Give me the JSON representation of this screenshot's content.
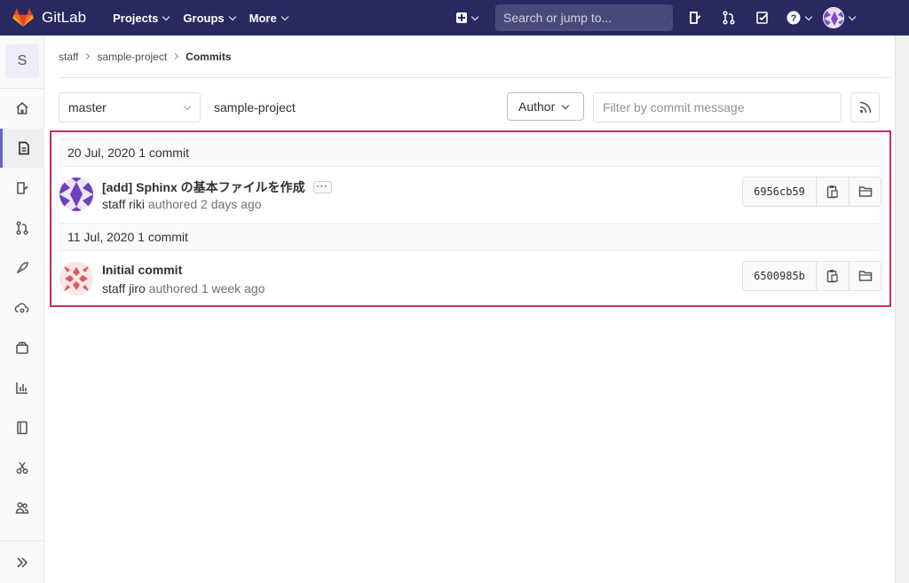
{
  "navbar": {
    "brand": "GitLab",
    "menu": [
      {
        "label": "Projects"
      },
      {
        "label": "Groups"
      },
      {
        "label": "More"
      }
    ],
    "search_placeholder": "Search or jump to..."
  },
  "sidebar": {
    "project_initial": "S",
    "items": [
      {
        "icon": "home-icon"
      },
      {
        "icon": "repository-icon"
      },
      {
        "icon": "issues-icon"
      },
      {
        "icon": "merge-request-icon"
      },
      {
        "icon": "ci-cd-rocket-icon"
      },
      {
        "icon": "operations-cloud-icon"
      },
      {
        "icon": "packages-icon"
      },
      {
        "icon": "analytics-icon"
      },
      {
        "icon": "wiki-book-icon"
      },
      {
        "icon": "snippets-scissors-icon"
      },
      {
        "icon": "members-icon"
      },
      {
        "icon": "collapse-sidebar-icon"
      }
    ]
  },
  "breadcrumbs": [
    "staff",
    "sample-project",
    "Commits"
  ],
  "toolbar": {
    "branch": "master",
    "project_path": "sample-project",
    "author_label": "Author",
    "filter_placeholder": "Filter by commit message"
  },
  "commit_groups": [
    {
      "date": "20 Jul, 2020",
      "count": "1 commit",
      "commits": [
        {
          "title": "[add] Sphinx の基本ファイルを作成",
          "ellipsis": "···",
          "author": "staff riki",
          "authored": "authored 2 days ago",
          "sha": "6956cb59"
        }
      ]
    },
    {
      "date": "11 Jul, 2020",
      "count": "1 commit",
      "commits": [
        {
          "title": "Initial commit",
          "author": "staff jiro",
          "authored": "authored 1 week ago",
          "sha": "6500985b"
        }
      ]
    }
  ],
  "colors": {
    "navbar": "#292961",
    "highlight_border": "#cc2e5c",
    "sidebar_active": "#6666c4"
  }
}
